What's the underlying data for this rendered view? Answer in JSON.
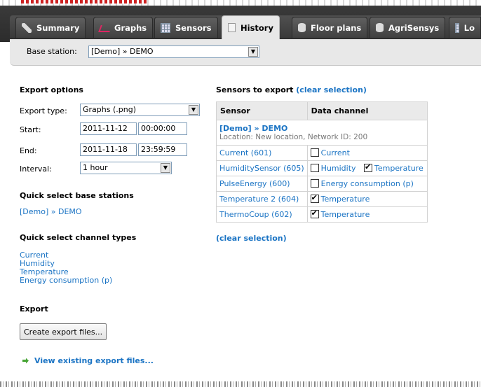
{
  "tabs": [
    {
      "label": "Summary",
      "icon": "summary-icon"
    },
    {
      "label": "Graphs",
      "icon": "graph-icon"
    },
    {
      "label": "Sensors",
      "icon": "table-icon"
    },
    {
      "label": "History",
      "icon": "document-icon",
      "active": true
    },
    {
      "label": "Floor plans",
      "icon": "database-icon"
    },
    {
      "label": "AgriSensys",
      "icon": "database-icon"
    },
    {
      "label": "Lo",
      "icon": "table-icon"
    }
  ],
  "base_station": {
    "label": "Base station:",
    "value": "[Demo] » DEMO"
  },
  "export_options": {
    "title": "Export options",
    "type_label": "Export type:",
    "type_value": "Graphs (.png)",
    "start_label": "Start:",
    "start_date": "2011-11-12",
    "start_time": "00:00:00",
    "end_label": "End:",
    "end_date": "2011-11-18",
    "end_time": "23:59:59",
    "interval_label": "Interval:",
    "interval_value": "1 hour"
  },
  "quick_select_base": {
    "title": "Quick select base stations",
    "items": [
      "[Demo] » DEMO"
    ]
  },
  "quick_select_channels": {
    "title": "Quick select channel types",
    "items": [
      "Current",
      "Humidity",
      "Temperature",
      "Energy consumption (p)"
    ]
  },
  "export": {
    "title": "Export",
    "button": "Create export files...",
    "view_link": "View existing export files..."
  },
  "sensors_export": {
    "title": "Sensors to export",
    "clear": "(clear selection)",
    "col_sensor": "Sensor",
    "col_channel": "Data channel",
    "station_name": "[Demo] » DEMO",
    "station_location": "Location: New location, Network ID: 200",
    "rows": [
      {
        "sensor": "Current (601)",
        "channels": [
          {
            "name": "Current",
            "checked": false
          }
        ]
      },
      {
        "sensor": "HumiditySensor (605)",
        "channels": [
          {
            "name": "Humidity",
            "checked": false
          },
          {
            "name": "Temperature",
            "checked": true
          }
        ]
      },
      {
        "sensor": "PulseEnergy (600)",
        "channels": [
          {
            "name": "Energy consumption (p)",
            "checked": false
          }
        ]
      },
      {
        "sensor": "Temperature 2 (604)",
        "channels": [
          {
            "name": "Temperature",
            "checked": true
          }
        ]
      },
      {
        "sensor": "ThermoCoup (602)",
        "channels": [
          {
            "name": "Temperature",
            "checked": true
          }
        ]
      }
    ],
    "clear_bottom": "(clear selection)"
  },
  "colors": {
    "link": "#1b74c4",
    "tabbar": "#3a3a3a",
    "filter_bg": "#e8e8e8",
    "arrow": "#48a536"
  }
}
